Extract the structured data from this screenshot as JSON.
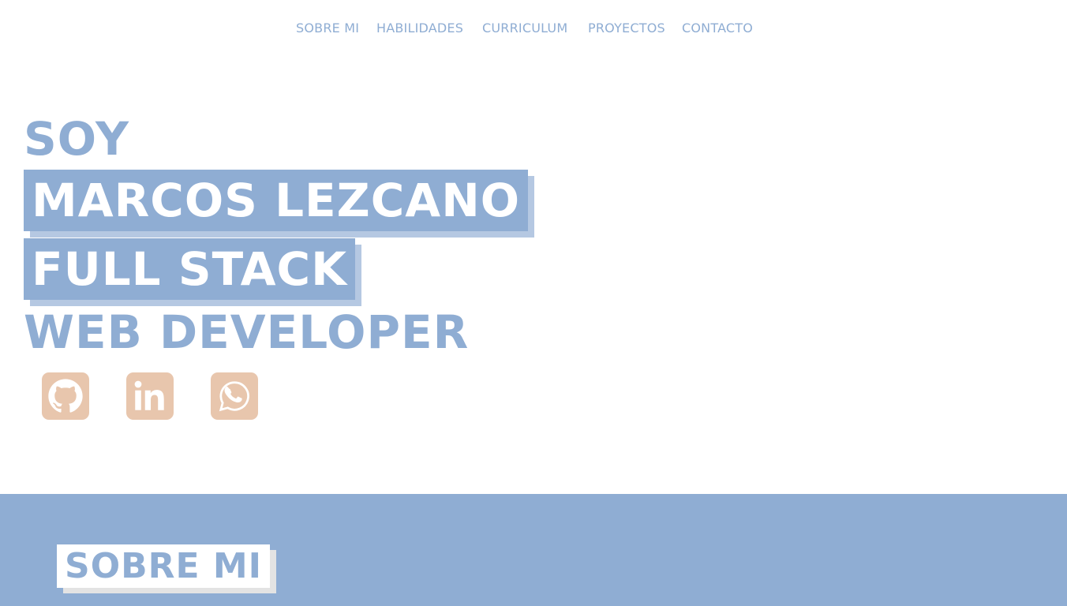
{
  "nav": {
    "items": [
      {
        "label": "SOBRE MI"
      },
      {
        "label": "HABILIDADES"
      },
      {
        "label": "CURRICULUM"
      },
      {
        "label": "PROYECTOS"
      },
      {
        "label": "CONTACTO"
      }
    ]
  },
  "hero": {
    "line1": "SOY",
    "name": "MARCOS LEZCANO",
    "role1": "FULL STACK",
    "role2": "WEB DEVELOPER"
  },
  "social": [
    {
      "icon": "github-icon"
    },
    {
      "icon": "linkedin-icon"
    },
    {
      "icon": "whatsapp-icon"
    }
  ],
  "about": {
    "title": "SOBRE MI"
  },
  "colors": {
    "accent": "#8fadd3",
    "accent_shadow": "#b5c8e2",
    "social_bg": "#e8c6ad",
    "background": "#ffffff"
  }
}
